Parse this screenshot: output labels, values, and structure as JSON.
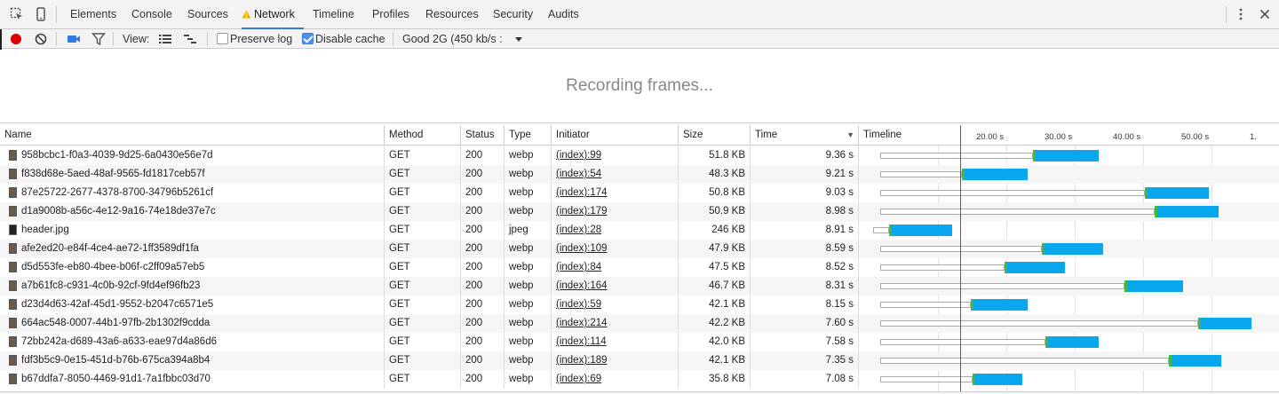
{
  "tabs": [
    {
      "label": "Elements",
      "active": false
    },
    {
      "label": "Console",
      "active": false
    },
    {
      "label": "Sources",
      "active": false
    },
    {
      "label": "Network",
      "active": true,
      "warning": true
    },
    {
      "label": "Timeline",
      "active": false
    },
    {
      "label": "Profiles",
      "active": false
    },
    {
      "label": "Resources",
      "active": false
    },
    {
      "label": "Security",
      "active": false
    },
    {
      "label": "Audits",
      "active": false
    }
  ],
  "toolbar": {
    "view_label": "View:",
    "preserve_log_label": "Preserve log",
    "preserve_log_checked": false,
    "disable_cache_label": "Disable cache",
    "disable_cache_checked": true,
    "throttle_value": "Good 2G (450 kb/s :"
  },
  "recording_text": "Recording frames...",
  "columns": [
    "Name",
    "Method",
    "Status",
    "Type",
    "Initiator",
    "Size",
    "Time",
    "Timeline"
  ],
  "timeline_ticks": [
    "20.00 s",
    "30.00 s",
    "40.00 s",
    "50.00 s",
    "1."
  ],
  "colors": {
    "accent": "#3879d9",
    "receive": "#0aa7ee",
    "ttfb": "#3eba3e",
    "record": "#e00000"
  },
  "rows": [
    {
      "name": "958bcbc1-f0a3-4039-9d25-6a0430e56e7d",
      "method": "GET",
      "status": "200",
      "type": "webp",
      "initiator": "(index):99",
      "size": "51.8 KB",
      "time": "9.36 s"
    },
    {
      "name": "f838d68e-5aed-48af-9565-fd1817ceb57f",
      "method": "GET",
      "status": "200",
      "type": "webp",
      "initiator": "(index):54",
      "size": "48.3 KB",
      "time": "9.21 s"
    },
    {
      "name": "87e25722-2677-4378-8700-34796b5261cf",
      "method": "GET",
      "status": "200",
      "type": "webp",
      "initiator": "(index):174",
      "size": "50.8 KB",
      "time": "9.03 s"
    },
    {
      "name": "d1a9008b-a56c-4e12-9a16-74e18de37e7c",
      "method": "GET",
      "status": "200",
      "type": "webp",
      "initiator": "(index):179",
      "size": "50.9 KB",
      "time": "8.98 s"
    },
    {
      "name": "header.jpg",
      "method": "GET",
      "status": "200",
      "type": "jpeg",
      "initiator": "(index):28",
      "size": "246 KB",
      "time": "8.91 s"
    },
    {
      "name": "afe2ed20-e84f-4ce4-ae72-1ff3589df1fa",
      "method": "GET",
      "status": "200",
      "type": "webp",
      "initiator": "(index):109",
      "size": "47.9 KB",
      "time": "8.59 s"
    },
    {
      "name": "d5d553fe-eb80-4bee-b06f-c2ff09a57eb5",
      "method": "GET",
      "status": "200",
      "type": "webp",
      "initiator": "(index):84",
      "size": "47.5 KB",
      "time": "8.52 s"
    },
    {
      "name": "a7b61fc8-c931-4c0b-92cf-9fd4ef96fb23",
      "method": "GET",
      "status": "200",
      "type": "webp",
      "initiator": "(index):164",
      "size": "46.7 KB",
      "time": "8.31 s"
    },
    {
      "name": "d23d4d63-42af-45d1-9552-b2047c6571e5",
      "method": "GET",
      "status": "200",
      "type": "webp",
      "initiator": "(index):59",
      "size": "42.1 KB",
      "time": "8.15 s"
    },
    {
      "name": "664ac548-0007-44b1-97fb-2b1302f9cdda",
      "method": "GET",
      "status": "200",
      "type": "webp",
      "initiator": "(index):214",
      "size": "42.2 KB",
      "time": "7.60 s"
    },
    {
      "name": "72bb242a-d689-43a6-a633-eae97d4a86d6",
      "method": "GET",
      "status": "200",
      "type": "webp",
      "initiator": "(index):114",
      "size": "42.0 KB",
      "time": "7.58 s"
    },
    {
      "name": "fdf3b5c9-0e15-451d-b76b-675ca394a8b4",
      "method": "GET",
      "status": "200",
      "type": "webp",
      "initiator": "(index):189",
      "size": "42.1 KB",
      "time": "7.35 s"
    },
    {
      "name": "b67ddfa7-8050-4469-91d1-7a1fbbc03d70",
      "method": "GET",
      "status": "200",
      "type": "webp",
      "initiator": "(index):69",
      "size": "35.8 KB",
      "time": "7.08 s"
    }
  ]
}
